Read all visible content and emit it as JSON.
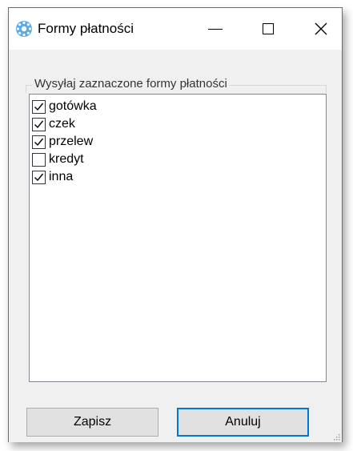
{
  "window": {
    "title": "Formy płatności",
    "icon": "gear-app-icon",
    "controls": {
      "minimize_icon": "minimize-icon",
      "maximize_icon": "maximize-icon",
      "close_icon": "close-icon",
      "close_glyph": "✕"
    }
  },
  "group": {
    "legend": "Wysyłaj zaznaczone formy płatności"
  },
  "payment_methods": [
    {
      "label": "gotówka",
      "checked": true
    },
    {
      "label": "czek",
      "checked": true
    },
    {
      "label": "przelew",
      "checked": true
    },
    {
      "label": "kredyt",
      "checked": false
    },
    {
      "label": "inna",
      "checked": true
    }
  ],
  "buttons": {
    "save_label": "Zapisz",
    "cancel_label": "Anuluj"
  },
  "colors": {
    "accent": "#0078d7",
    "icon_blue": "#5aa9e6",
    "window_bg": "#f0f0f0"
  }
}
